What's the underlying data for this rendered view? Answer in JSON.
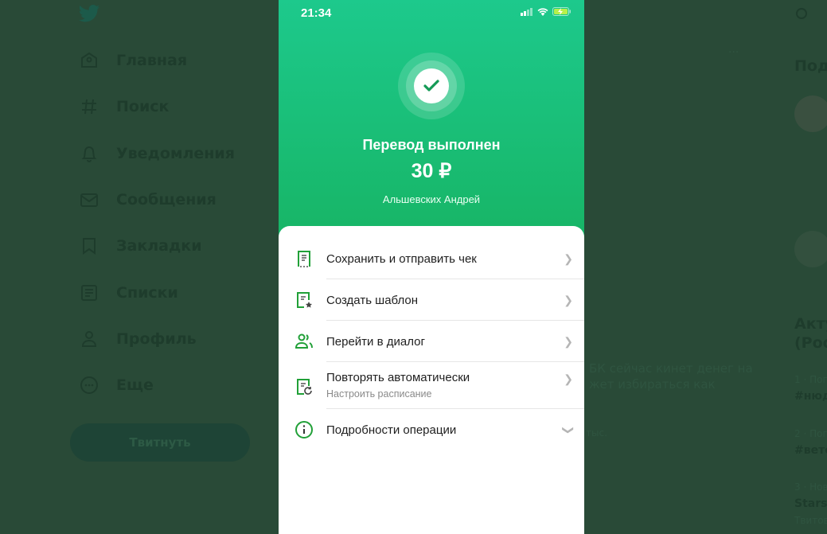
{
  "twitter": {
    "nav": [
      {
        "label": "Главная",
        "icon": "home-icon"
      },
      {
        "label": "Поиск",
        "icon": "hashtag-icon"
      },
      {
        "label": "Уведомления",
        "icon": "bell-icon"
      },
      {
        "label": "Сообщения",
        "icon": "envelope-icon"
      },
      {
        "label": "Закладки",
        "icon": "bookmark-icon"
      },
      {
        "label": "Списки",
        "icon": "list-icon"
      },
      {
        "label": "Профиль",
        "icon": "person-icon"
      },
      {
        "label": "Еще",
        "icon": "more-icon"
      }
    ],
    "tweet_button": "Твитнуть",
    "right": {
      "follow_heading": "Под",
      "trends_heading_1": "Акту",
      "trends_heading_2": "(Рос",
      "trends": [
        {
          "meta": "1 · Поп",
          "tag": "#нюд"
        },
        {
          "meta": "2 · Поп",
          "tag": "#вете"
        },
        {
          "meta": "3 · Нов",
          "tag": "Starsh",
          "count": "Твитов"
        }
      ]
    },
    "background_tweet": {
      "line1": "БК сейчас кинет денег на",
      "line2": "жет избираться как",
      "stat": "тыс."
    }
  },
  "phone": {
    "status_time": "21:34",
    "title": "Перевод выполнен",
    "amount": "30 ₽",
    "recipient": "Альшевских Андрей",
    "actions": [
      {
        "label": "Сохранить и отправить чек",
        "icon": "receipt-icon"
      },
      {
        "label": "Создать шаблон",
        "icon": "template-star-icon"
      },
      {
        "label": "Перейти в диалог",
        "icon": "people-icon"
      },
      {
        "label": "Повторять автоматически",
        "sublabel": "Настроить расписание",
        "icon": "repeat-doc-icon"
      },
      {
        "label": "Подробности операции",
        "icon": "info-icon"
      }
    ],
    "accent": "#21a038"
  }
}
